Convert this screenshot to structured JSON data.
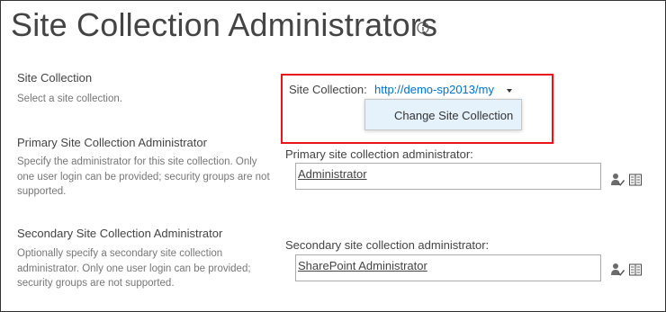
{
  "page": {
    "title": "Site Collection Administrators",
    "info_icon": "info-icon"
  },
  "site_collection": {
    "title": "Site Collection",
    "description": "Select a site collection.",
    "field_label": "Site Collection:",
    "value": "http://demo-sp2013/my",
    "dropdown_icon": "caret-down-icon",
    "menu_item": "Change Site Collection"
  },
  "primary": {
    "title": "Primary Site Collection Administrator",
    "description": "Specify the administrator for this site collection. Only one user login can be provided; security groups are not supported.",
    "field_label": "Primary site collection administrator:",
    "value": "Administrator",
    "check_icon": "check-names-icon",
    "browse_icon": "address-book-icon"
  },
  "secondary": {
    "title": "Secondary Site Collection Administrator",
    "description": "Optionally specify a secondary site collection administrator. Only one user login can be provided; security groups are not supported.",
    "field_label": "Secondary site collection administrator:",
    "value": "SharePoint Administrator",
    "check_icon": "check-names-icon",
    "browse_icon": "address-book-icon"
  },
  "colors": {
    "link": "#0072c6",
    "highlight_border": "#e8141b",
    "menu_background": "#e6f2fb"
  }
}
